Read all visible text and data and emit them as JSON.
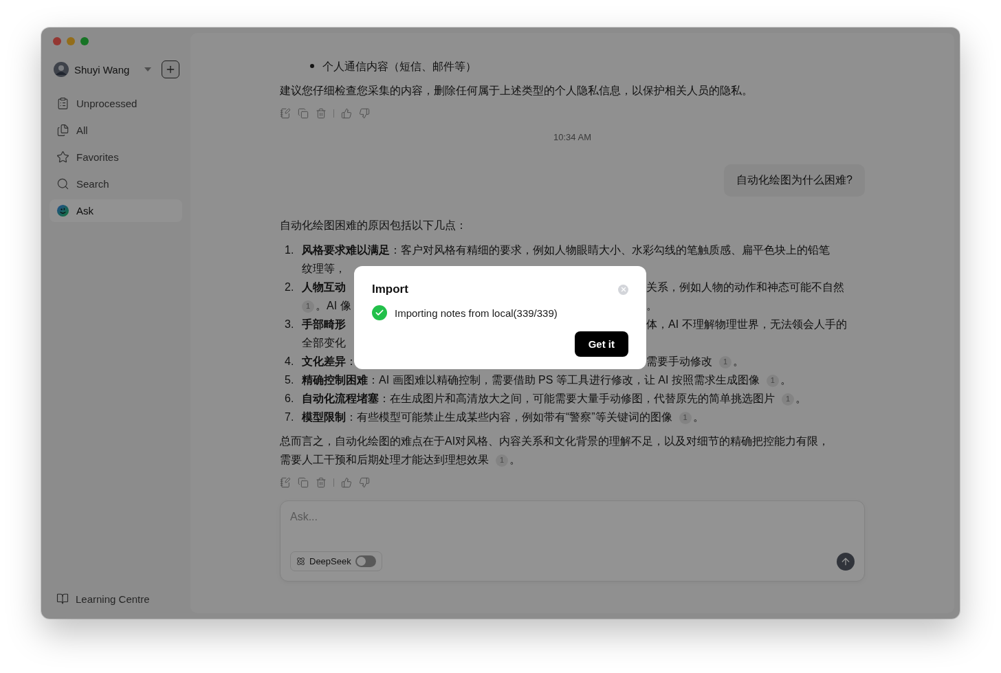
{
  "sidebar": {
    "user": {
      "name": "Shuyi Wang"
    },
    "nav": [
      {
        "label": "Unprocessed",
        "selected": false
      },
      {
        "label": "All",
        "selected": false
      },
      {
        "label": "Favorites",
        "selected": false
      },
      {
        "label": "Search",
        "selected": false
      },
      {
        "label": "Ask",
        "selected": true
      }
    ],
    "footer": {
      "label": "Learning Centre"
    }
  },
  "chat": {
    "bullets": [
      "个人通信内容（短信、邮件等）"
    ],
    "paragraph": "建议您仔细检查您采集的内容，删除任何属于上述类型的个人隐私信息，以保护相关人员的隐私。",
    "time": "10:34 AM",
    "question": "自动化绘图为什么困难?",
    "answer": {
      "intro": "自动化绘图困难的原因包括以下几点：",
      "items": [
        {
          "number": "1.",
          "lines": [
            {
              "parts": [
                {
                  "kind": "title",
                  "text": "风格要求难以满足"
                },
                {
                  "kind": "text",
                  "text": "：客户对风格有精细的要求，例如人物眼睛大小、水彩勾线的笔触质感、扁平色块上的铅笔"
                }
              ]
            },
            {
              "left": [
                {
                  "kind": "text",
                  "text": "纹理等，"
                }
              ]
            }
          ]
        },
        {
          "number": "2.",
          "lines": [
            {
              "left": [
                {
                  "kind": "title",
                  "text": "人物互动"
                }
              ],
              "right": [
                {
                  "kind": "text",
                  "text": "关系，例如人物的动作和神态可能不自然"
                }
              ]
            },
            {
              "left": [
                {
                  "kind": "cite",
                  "text": "1"
                },
                {
                  "kind": "text",
                  "text": "。AI 像"
                }
              ],
              "right": [
                {
                  "kind": "text",
                  "text": "。"
                }
              ]
            }
          ]
        },
        {
          "number": "3.",
          "lines": [
            {
              "left": [
                {
                  "kind": "title",
                  "text": "手部畸形"
                }
              ],
              "right": [
                {
                  "kind": "text",
                  "text": "体，AI 不理解物理世界，无法领会人手的"
                }
              ]
            },
            {
              "parts": [
                {
                  "kind": "text",
                  "text": "全部变化"
                }
              ]
            }
          ]
        },
        {
          "number": "4.",
          "lines": [
            {
              "left": [
                {
                  "kind": "title",
                  "text": "文化差异"
                },
                {
                  "kind": "text",
                  "text": "："
                }
              ],
              "right": [
                {
                  "kind": "text",
                  "text": "需要手动修改"
                },
                {
                  "kind": "cite",
                  "text": "1"
                },
                {
                  "kind": "text",
                  "text": "。"
                }
              ]
            }
          ]
        },
        {
          "number": "5.",
          "lines": [
            {
              "parts": [
                {
                  "kind": "title",
                  "text": "精确控制困难"
                },
                {
                  "kind": "text",
                  "text": "：AI 画图难以精确控制，需要借助 PS 等工具进行修改，让 AI 按照需求生成图像"
                },
                {
                  "kind": "cite",
                  "text": "1"
                },
                {
                  "kind": "text",
                  "text": "。"
                }
              ]
            }
          ]
        },
        {
          "number": "6.",
          "lines": [
            {
              "parts": [
                {
                  "kind": "title",
                  "text": "自动化流程堵塞"
                },
                {
                  "kind": "text",
                  "text": "：在生成图片和高清放大之间，可能需要大量手动修图，代替原先的简单挑选图片"
                },
                {
                  "kind": "cite",
                  "text": "1"
                },
                {
                  "kind": "text",
                  "text": "。"
                }
              ]
            }
          ]
        },
        {
          "number": "7.",
          "lines": [
            {
              "parts": [
                {
                  "kind": "title",
                  "text": "模型限制"
                },
                {
                  "kind": "text",
                  "text": "：有些模型可能禁止生成某些内容，例如带有“警察”等关键词的图像"
                },
                {
                  "kind": "cite",
                  "text": "1"
                },
                {
                  "kind": "text",
                  "text": "。"
                }
              ]
            }
          ]
        }
      ],
      "summary": [
        {
          "parts": [
            {
              "kind": "text",
              "text": "总而言之，自动化绘图的难点在于AI对风格、内容关系和文化背景的理解不足，以及对细节的精确把控能力有限，"
            }
          ]
        },
        {
          "parts": [
            {
              "kind": "text",
              "text": "需要人工干预和后期处理才能达到理想效果"
            },
            {
              "kind": "cite",
              "text": "1"
            },
            {
              "kind": "text",
              "text": "。"
            }
          ]
        }
      ]
    }
  },
  "composer": {
    "placeholder": "Ask...",
    "model": {
      "label": "DeepSeek",
      "on": false
    }
  },
  "dialog": {
    "title": "Import",
    "status": "Importing notes from local(339/339)",
    "button": "Get it"
  }
}
